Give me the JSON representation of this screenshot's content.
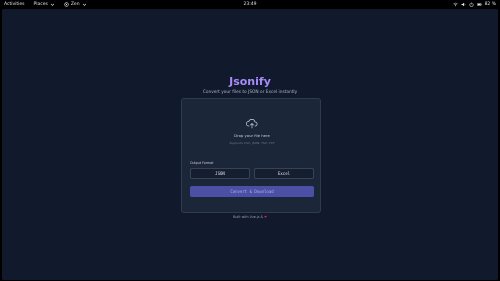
{
  "topbar": {
    "activities": "Activities",
    "places": "Places",
    "app_name": "Zen",
    "clock": "23:49",
    "battery": "82 %"
  },
  "app": {
    "title": "Jsonify",
    "tagline": "Convert your files to JSON or Excel instantly",
    "dropzone": {
      "icon": "cloud-upload-icon",
      "title": "Drop your file here",
      "supports": "Supports CSV, JSON, TSV, TXT"
    },
    "output_format_label": "Output Format",
    "formats": [
      "JSON",
      "Excel"
    ],
    "convert_button": "Convert & Download",
    "footer_prefix": "Built with Vue.js & ",
    "footer_heart": "❤"
  },
  "colors": {
    "brand": "#a78bfa",
    "background": "#111a2c",
    "card": "#1c2639",
    "button": "#4c4fa6"
  }
}
